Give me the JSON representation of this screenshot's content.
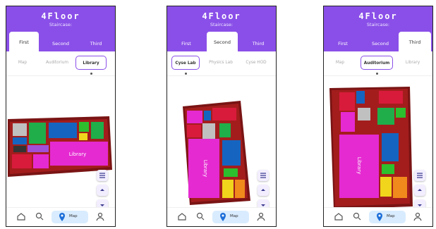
{
  "screens": [
    {
      "title": "4Floor",
      "subtitle": "Staircase:",
      "tabs": [
        "First",
        "Second",
        "Third"
      ],
      "active_tab": "First",
      "locations": [
        "Map",
        "Auditorium",
        "Library"
      ],
      "active_location": "Library",
      "map_room_label": "Library",
      "nav_map_label": "Map"
    },
    {
      "title": "4Floor",
      "subtitle": "Staircase:",
      "tabs": [
        "First",
        "Second",
        "Third"
      ],
      "active_tab": "Second",
      "locations": [
        "Cyse Lab",
        "Physics Lab",
        "Cyse HOD"
      ],
      "active_location": "Cyse Lab",
      "map_room_label": "Library",
      "nav_map_label": "Map"
    },
    {
      "title": "4Floor",
      "subtitle": "Staircase:",
      "tabs": [
        "First",
        "Second",
        "Third"
      ],
      "active_tab": "Third",
      "locations": [
        "Map",
        "Auditorium",
        "Library"
      ],
      "active_location": "Auditorium",
      "map_room_label": "Library",
      "nav_map_label": "Map"
    }
  ],
  "colors": {
    "header": "#8a4fe8",
    "floor_border": "#7a1414",
    "library": "#e52ad1",
    "nav_map_active": "#d9ecff"
  },
  "icons": {
    "nav": [
      "home-icon",
      "search-icon",
      "map-pin-icon",
      "user-icon"
    ],
    "fab": [
      "list-icon",
      "chevron-up-icon",
      "chevron-down-icon"
    ]
  }
}
